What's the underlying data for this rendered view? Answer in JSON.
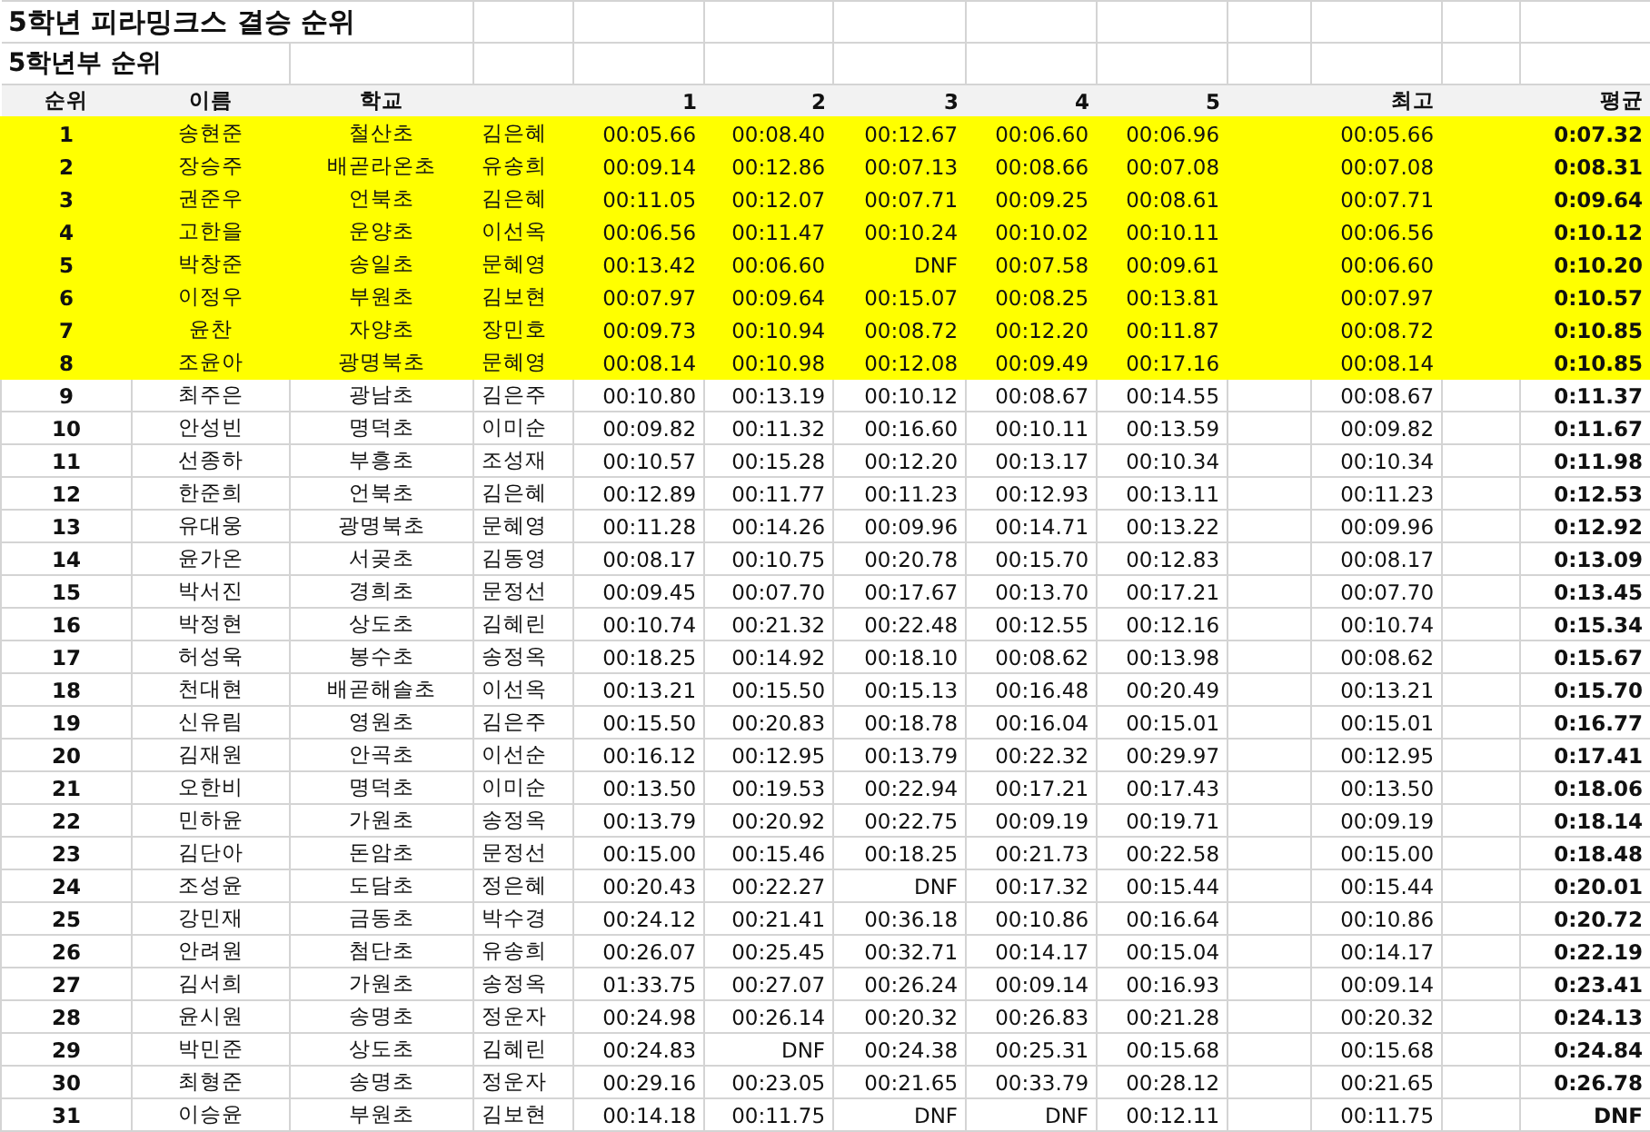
{
  "title": "5학년 피라밍크스 결승 순위",
  "subtitle": "5학년부 순위",
  "columns": {
    "rank": "순위",
    "name": "이름",
    "school": "학교",
    "trials": [
      "1",
      "2",
      "3",
      "4",
      "5"
    ],
    "best": "최고",
    "average": "평균"
  },
  "rows": [
    {
      "rank": "1",
      "name": "송현준",
      "school": "철산초",
      "teacher": "김은혜",
      "times": [
        "00:05.66",
        "00:08.40",
        "00:12.67",
        "00:06.60",
        "00:06.96"
      ],
      "best": "00:05.66",
      "average": "0:07.32",
      "highlighted": true
    },
    {
      "rank": "2",
      "name": "장승주",
      "school": "배곧라온초",
      "teacher": "유송희",
      "times": [
        "00:09.14",
        "00:12.86",
        "00:07.13",
        "00:08.66",
        "00:07.08"
      ],
      "best": "00:07.08",
      "average": "0:08.31",
      "highlighted": true
    },
    {
      "rank": "3",
      "name": "권준우",
      "school": "언북초",
      "teacher": "김은혜",
      "times": [
        "00:11.05",
        "00:12.07",
        "00:07.71",
        "00:09.25",
        "00:08.61"
      ],
      "best": "00:07.71",
      "average": "0:09.64",
      "highlighted": true
    },
    {
      "rank": "4",
      "name": "고한을",
      "school": "운양초",
      "teacher": "이선옥",
      "times": [
        "00:06.56",
        "00:11.47",
        "00:10.24",
        "00:10.02",
        "00:10.11"
      ],
      "best": "00:06.56",
      "average": "0:10.12",
      "highlighted": true
    },
    {
      "rank": "5",
      "name": "박창준",
      "school": "송일초",
      "teacher": "문혜영",
      "times": [
        "00:13.42",
        "00:06.60",
        "DNF",
        "00:07.58",
        "00:09.61"
      ],
      "best": "00:06.60",
      "average": "0:10.20",
      "highlighted": true
    },
    {
      "rank": "6",
      "name": "이정우",
      "school": "부원초",
      "teacher": "김보현",
      "times": [
        "00:07.97",
        "00:09.64",
        "00:15.07",
        "00:08.25",
        "00:13.81"
      ],
      "best": "00:07.97",
      "average": "0:10.57",
      "highlighted": true
    },
    {
      "rank": "7",
      "name": "윤찬",
      "school": "자양초",
      "teacher": "장민호",
      "times": [
        "00:09.73",
        "00:10.94",
        "00:08.72",
        "00:12.20",
        "00:11.87"
      ],
      "best": "00:08.72",
      "average": "0:10.85",
      "highlighted": true
    },
    {
      "rank": "8",
      "name": "조윤아",
      "school": "광명북초",
      "teacher": "문혜영",
      "times": [
        "00:08.14",
        "00:10.98",
        "00:12.08",
        "00:09.49",
        "00:17.16"
      ],
      "best": "00:08.14",
      "average": "0:10.85",
      "highlighted": true
    },
    {
      "rank": "9",
      "name": "최주은",
      "school": "광남초",
      "teacher": "김은주",
      "times": [
        "00:10.80",
        "00:13.19",
        "00:10.12",
        "00:08.67",
        "00:14.55"
      ],
      "best": "00:08.67",
      "average": "0:11.37",
      "highlighted": false
    },
    {
      "rank": "10",
      "name": "안성빈",
      "school": "명덕초",
      "teacher": "이미순",
      "times": [
        "00:09.82",
        "00:11.32",
        "00:16.60",
        "00:10.11",
        "00:13.59"
      ],
      "best": "00:09.82",
      "average": "0:11.67",
      "highlighted": false
    },
    {
      "rank": "11",
      "name": "선종하",
      "school": "부흥초",
      "teacher": "조성재",
      "times": [
        "00:10.57",
        "00:15.28",
        "00:12.20",
        "00:13.17",
        "00:10.34"
      ],
      "best": "00:10.34",
      "average": "0:11.98",
      "highlighted": false
    },
    {
      "rank": "12",
      "name": "한준희",
      "school": "언북초",
      "teacher": "김은혜",
      "times": [
        "00:12.89",
        "00:11.77",
        "00:11.23",
        "00:12.93",
        "00:13.11"
      ],
      "best": "00:11.23",
      "average": "0:12.53",
      "highlighted": false
    },
    {
      "rank": "13",
      "name": "유대웅",
      "school": "광명북초",
      "teacher": "문혜영",
      "times": [
        "00:11.28",
        "00:14.26",
        "00:09.96",
        "00:14.71",
        "00:13.22"
      ],
      "best": "00:09.96",
      "average": "0:12.92",
      "highlighted": false
    },
    {
      "rank": "14",
      "name": "윤가온",
      "school": "서곶초",
      "teacher": "김동영",
      "times": [
        "00:08.17",
        "00:10.75",
        "00:20.78",
        "00:15.70",
        "00:12.83"
      ],
      "best": "00:08.17",
      "average": "0:13.09",
      "highlighted": false
    },
    {
      "rank": "15",
      "name": "박서진",
      "school": "경희초",
      "teacher": "문정선",
      "times": [
        "00:09.45",
        "00:07.70",
        "00:17.67",
        "00:13.70",
        "00:17.21"
      ],
      "best": "00:07.70",
      "average": "0:13.45",
      "highlighted": false
    },
    {
      "rank": "16",
      "name": "박정현",
      "school": "상도초",
      "teacher": "김혜린",
      "times": [
        "00:10.74",
        "00:21.32",
        "00:22.48",
        "00:12.55",
        "00:12.16"
      ],
      "best": "00:10.74",
      "average": "0:15.34",
      "highlighted": false
    },
    {
      "rank": "17",
      "name": "허성욱",
      "school": "봉수초",
      "teacher": "송정옥",
      "times": [
        "00:18.25",
        "00:14.92",
        "00:18.10",
        "00:08.62",
        "00:13.98"
      ],
      "best": "00:08.62",
      "average": "0:15.67",
      "highlighted": false
    },
    {
      "rank": "18",
      "name": "천대현",
      "school": "배곧해솔초",
      "teacher": "이선옥",
      "times": [
        "00:13.21",
        "00:15.50",
        "00:15.13",
        "00:16.48",
        "00:20.49"
      ],
      "best": "00:13.21",
      "average": "0:15.70",
      "highlighted": false
    },
    {
      "rank": "19",
      "name": "신유림",
      "school": "영원초",
      "teacher": "김은주",
      "times": [
        "00:15.50",
        "00:20.83",
        "00:18.78",
        "00:16.04",
        "00:15.01"
      ],
      "best": "00:15.01",
      "average": "0:16.77",
      "highlighted": false
    },
    {
      "rank": "20",
      "name": "김재원",
      "school": "안곡초",
      "teacher": "이선순",
      "times": [
        "00:16.12",
        "00:12.95",
        "00:13.79",
        "00:22.32",
        "00:29.97"
      ],
      "best": "00:12.95",
      "average": "0:17.41",
      "highlighted": false
    },
    {
      "rank": "21",
      "name": "오한비",
      "school": "명덕초",
      "teacher": "이미순",
      "times": [
        "00:13.50",
        "00:19.53",
        "00:22.94",
        "00:17.21",
        "00:17.43"
      ],
      "best": "00:13.50",
      "average": "0:18.06",
      "highlighted": false
    },
    {
      "rank": "22",
      "name": "민하윤",
      "school": "가원초",
      "teacher": "송정옥",
      "times": [
        "00:13.79",
        "00:20.92",
        "00:22.75",
        "00:09.19",
        "00:19.71"
      ],
      "best": "00:09.19",
      "average": "0:18.14",
      "highlighted": false
    },
    {
      "rank": "23",
      "name": "김단아",
      "school": "돈암초",
      "teacher": "문정선",
      "times": [
        "00:15.00",
        "00:15.46",
        "00:18.25",
        "00:21.73",
        "00:22.58"
      ],
      "best": "00:15.00",
      "average": "0:18.48",
      "highlighted": false
    },
    {
      "rank": "24",
      "name": "조성윤",
      "school": "도담초",
      "teacher": "정은혜",
      "times": [
        "00:20.43",
        "00:22.27",
        "DNF",
        "00:17.32",
        "00:15.44"
      ],
      "best": "00:15.44",
      "average": "0:20.01",
      "highlighted": false
    },
    {
      "rank": "25",
      "name": "강민재",
      "school": "금동초",
      "teacher": "박수경",
      "times": [
        "00:24.12",
        "00:21.41",
        "00:36.18",
        "00:10.86",
        "00:16.64"
      ],
      "best": "00:10.86",
      "average": "0:20.72",
      "highlighted": false
    },
    {
      "rank": "26",
      "name": "안려원",
      "school": "첨단초",
      "teacher": "유송희",
      "times": [
        "00:26.07",
        "00:25.45",
        "00:32.71",
        "00:14.17",
        "00:15.04"
      ],
      "best": "00:14.17",
      "average": "0:22.19",
      "highlighted": false
    },
    {
      "rank": "27",
      "name": "김서희",
      "school": "가원초",
      "teacher": "송정옥",
      "times": [
        "01:33.75",
        "00:27.07",
        "00:26.24",
        "00:09.14",
        "00:16.93"
      ],
      "best": "00:09.14",
      "average": "0:23.41",
      "highlighted": false
    },
    {
      "rank": "28",
      "name": "윤시원",
      "school": "송명초",
      "teacher": "정운자",
      "times": [
        "00:24.98",
        "00:26.14",
        "00:20.32",
        "00:26.83",
        "00:21.28"
      ],
      "best": "00:20.32",
      "average": "0:24.13",
      "highlighted": false
    },
    {
      "rank": "29",
      "name": "박민준",
      "school": "상도초",
      "teacher": "김혜린",
      "times": [
        "00:24.83",
        "DNF",
        "00:24.38",
        "00:25.31",
        "00:15.68"
      ],
      "best": "00:15.68",
      "average": "0:24.84",
      "highlighted": false
    },
    {
      "rank": "30",
      "name": "최형준",
      "school": "송명초",
      "teacher": "정운자",
      "times": [
        "00:29.16",
        "00:23.05",
        "00:21.65",
        "00:33.79",
        "00:28.12"
      ],
      "best": "00:21.65",
      "average": "0:26.78",
      "highlighted": false
    },
    {
      "rank": "31",
      "name": "이승윤",
      "school": "부원초",
      "teacher": "김보현",
      "times": [
        "00:14.18",
        "00:11.75",
        "DNF",
        "DNF",
        "00:12.11"
      ],
      "best": "00:11.75",
      "average": "DNF",
      "highlighted": false
    }
  ]
}
